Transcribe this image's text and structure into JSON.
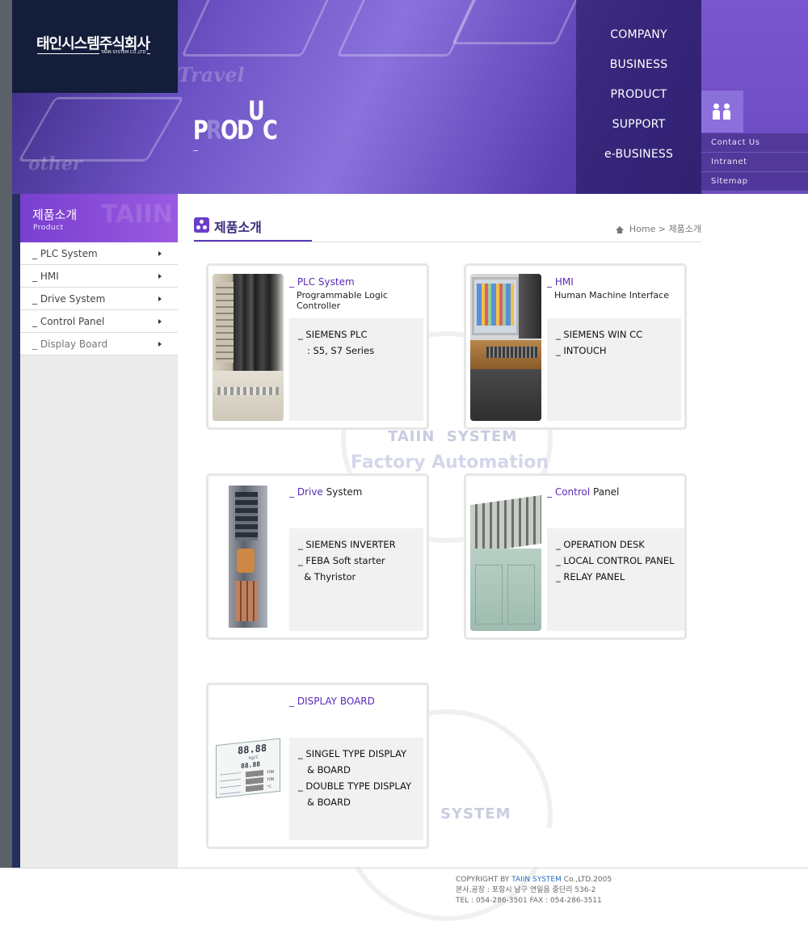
{
  "header": {
    "logo_ko": "태인시스템주식회사",
    "logo_en": "TAIIN SYSTEM CO.,LTD",
    "section_word": [
      "P",
      "R",
      "O",
      "D",
      "U",
      "C"
    ],
    "nav": [
      "COMPANY",
      "BUSINESS",
      "PRODUCT",
      "SUPPORT",
      "e-BUSINESS"
    ],
    "util": [
      "Contact Us",
      "Intranet",
      "Sitemap"
    ]
  },
  "sidebar": {
    "title_ko": "제품소개",
    "title_en": "Product",
    "watermark": "TAIIN",
    "items": [
      "_ PLC System",
      "_ HMI",
      "_ Drive System",
      "_ Control Panel",
      "_ Display Board"
    ]
  },
  "content": {
    "title": "제품소개",
    "breadcrumb": [
      "Home",
      "제품소개"
    ],
    "watermark_line1": "TAIIN  SYSTEM",
    "watermark_line2": "Factory Automation",
    "watermark_line3": "SYSTEM"
  },
  "cards": [
    {
      "title_accent": "_ PLC System",
      "title_rest": "",
      "subtitle": "Programmable Logic Controller",
      "lines": [
        "_ SIEMENS PLC",
        "   : S5, S7 Series"
      ],
      "image": "plc-rack-image"
    },
    {
      "title_accent": "_ HMI",
      "title_rest": "",
      "subtitle": "Human Machine Interface",
      "lines": [
        "_ SIEMENS WIN CC",
        "_ INTOUCH"
      ],
      "image": "hmi-console-image"
    },
    {
      "title_accent": "_ Drive",
      "title_rest": " System",
      "subtitle": "",
      "lines": [
        "_ SIEMENS INVERTER",
        "_ FEBA Soft starter",
        "  & Thyristor"
      ],
      "image": "drive-cabinet-image"
    },
    {
      "title_accent": "_ Control",
      "title_rest": " Panel",
      "subtitle": "",
      "lines": [
        "_ OPERATION DESK",
        "_ LOCAL CONTROL PANEL",
        "_ RELAY PANEL"
      ],
      "image": "control-desk-image"
    },
    {
      "title_accent": "_ DISPLAY BOARD",
      "title_rest": "",
      "subtitle": "",
      "lines": [
        "_ SINGEL TYPE DISPLAY",
        "   & BOARD",
        "_ DOUBLE TYPE DISPLAY",
        "   & BOARD"
      ],
      "image": "display-board-image"
    }
  ],
  "display_board_image_text": {
    "digits_top": "88.88",
    "unit": "kg/C",
    "digits_mid": "88.88",
    "rows": [
      "TON",
      "TON",
      "°C"
    ]
  },
  "footer": {
    "copyright_prefix": "COPYRIGHT BY ",
    "copyright_brand": "TAIIN SYSTEM",
    "copyright_suffix": " Co.,LTD.2005",
    "address": "본사,공장 : 포항시 남구 연일읍 중단리 536-2",
    "tel": "TEL : 054-286-3501 FAX : 054-286-3511"
  },
  "colors": {
    "accent": "#5a2ab8",
    "header_purple": "#6c52c4",
    "logo_navy": "#141d3a"
  }
}
